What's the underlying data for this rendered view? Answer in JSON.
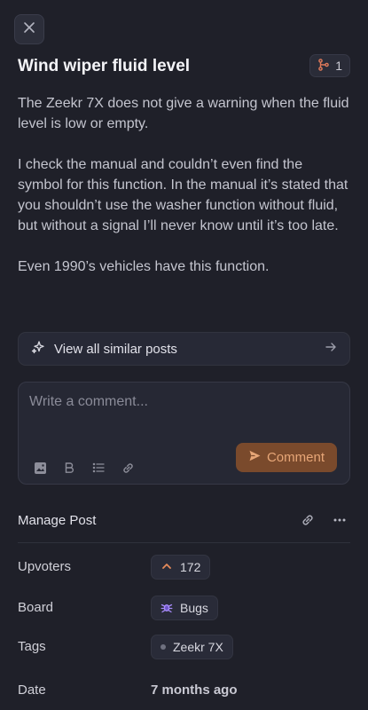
{
  "post": {
    "title": "Wind wiper fluid level",
    "merge_count": "1",
    "paragraphs": [
      "The Zeekr 7X does not give a warning when the fluid level is low or empty.",
      "I check the manual and couldn’t even find the symbol for this function. In the manual it’s stated that you shouldn’t use the washer function without fluid, but without a signal I’ll never know until it’s too late.",
      "Even 1990’s vehicles have this function."
    ]
  },
  "similar": {
    "label": "View all similar posts"
  },
  "comment": {
    "placeholder": "Write a comment...",
    "submit_label": "Comment"
  },
  "manage": {
    "label": "Manage Post"
  },
  "meta": {
    "upvoters_label": "Upvoters",
    "upvotes": "172",
    "board_label": "Board",
    "board_value": "Bugs",
    "tags_label": "Tags",
    "tag_value": "Zeekr 7X",
    "date_label": "Date",
    "date_value": "7 months ago"
  },
  "colors": {
    "background": "#1f2029",
    "accent": "#e7a677",
    "accent_bg": "#7a4a2c",
    "upvote_arrow": "#e58a5a",
    "merge_icon": "#e07a5a",
    "board_icon": "#a78bfa"
  },
  "icons": {
    "close": "close-icon",
    "merge": "merge-icon",
    "sparkle": "sparkle-icon",
    "arrow": "arrow-right-icon",
    "image": "image-icon",
    "bold": "bold-icon",
    "list": "list-icon",
    "link": "link-icon",
    "send": "send-icon",
    "more": "more-icon",
    "upvote": "upvote-arrow-icon",
    "bug": "bug-icon",
    "tag_dot": "tag-dot-icon"
  }
}
